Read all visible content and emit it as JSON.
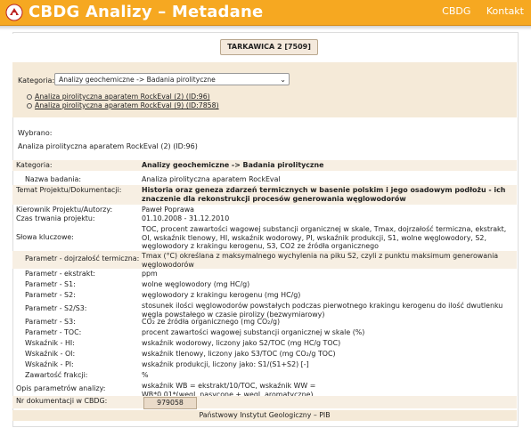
{
  "app": {
    "title": "CBDG Analizy – Metadane",
    "nav": [
      "CBDG",
      "Kontakt"
    ]
  },
  "well": {
    "label": "TARKAWICA 2 [7509]"
  },
  "category": {
    "label": "Kategoria:",
    "selected": "Analizy geochemiczne -> Badania pirolityczne",
    "links": [
      "Analiza pirolityczna aparatem RockEval (2) (ID:96)",
      "Analiza pirolityczna aparatem RockEval (9) (ID:7858)"
    ]
  },
  "selection": {
    "label": "Wybrano:",
    "value": "Analiza pirolityczna aparatem RockEval (2) (ID:96)"
  },
  "details": [
    {
      "key": "Kategoria:",
      "value": "Analizy geochemiczne -> Badania pirolityczne",
      "bold": true
    },
    {
      "key": "Nazwa badania:",
      "value": "Analiza pirolityczna aparatem RockEval"
    },
    {
      "key": "Temat Projektu/Dokumentacji:",
      "value": "Historia oraz geneza zdarzeń termicznych w basenie polskim i jego osadowym podłożu - ich znaczenie dla rekonstrukcji procesów generowania węglowodorów",
      "bold": true
    },
    {
      "key": "Kierownik Projektu/Autorzy:",
      "value": "Paweł Poprawa"
    },
    {
      "key": "Czas trwania projektu:",
      "value": "01.10.2008 - 31.12.2010"
    },
    {
      "key": "Słowa kluczowe:",
      "value": "TOC, procent zawartości wagowej substancji organicznej w skale, Tmax, dojrzałość termiczna, ekstrakt, OI, wskaźnik tlenowy, HI, wskaźnik wodorowy, PI, wskaźnik produkcji, S1, wolne węglowodory, S2, węglowodory z krakingu kerogenu, S3, CO2 ze źródła organicznego"
    },
    {
      "key": "Parametr - dojrzałość termiczna:",
      "value": "Tmax (°C) określana z maksymalnego wychylenia na piku S2, czyli z punktu maksimum generowania węglowodorów"
    },
    {
      "key": "Parametr - ekstrakt:",
      "value": "ppm"
    },
    {
      "key": "Parametr - S1:",
      "value": "wolne węglowodory (mg HC/g)"
    },
    {
      "key": "Parametr - S2:",
      "value": "węglowodory z krakingu kerogenu (mg HC/g)"
    },
    {
      "key": "Parametr - S2/S3:",
      "value": "stosunek ilości węglowodorów powstałych podczas pierwotnego krakingu kerogenu do ilość dwutlenku węgla powstałego w czasie pirolizy (bezwymiarowy)"
    },
    {
      "key": "Parametr - S3:",
      "value": "CO₂ ze źródła organicznego (mg CO₂/g)"
    },
    {
      "key": "Parametr - TOC:",
      "value": "procent zawartości wagowej substancji organicznej w skale (%)"
    },
    {
      "key": "Wskaźnik - HI:",
      "value": "wskaźnik wodorowy, liczony jako S2/TOC (mg HC/g TOC)"
    },
    {
      "key": "Wskaźnik - OI:",
      "value": "wskaźnik tlenowy, liczony jako S3/TOC (mg CO₂/g TOC)"
    },
    {
      "key": "Wskaźnik - PI:",
      "value": "wskaźnik produkcji, liczony jako: S1/(S1+S2) [-]"
    },
    {
      "key": "Zawartość frakcji:",
      "value": "%"
    },
    {
      "key": "Opis parametrów analizy:",
      "value": "wskaźnik WB = ekstrakt/10/TOC, wskaźnik WW = WB*0,01*(węgl. nasycone + węgl. aromatyczne)"
    },
    {
      "key": "Nr dokumentacji w CBDG:",
      "value": "979058"
    }
  ],
  "footer": "Państwowy Instytut Geologiczny – PIB",
  "colors": {
    "topbar": "#f6a821",
    "band": "#f5ead8",
    "shade": "#f7efe3"
  }
}
